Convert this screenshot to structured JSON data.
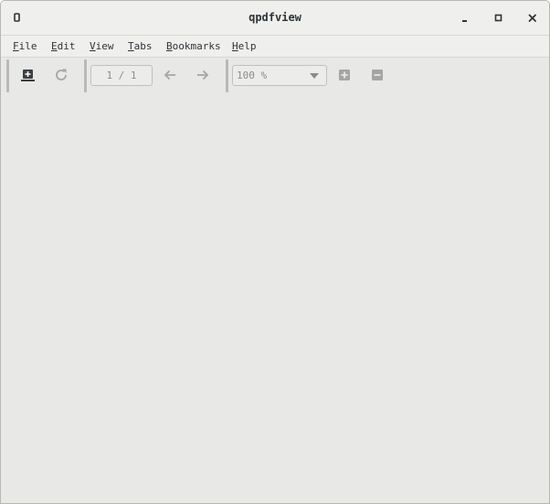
{
  "window": {
    "title": "qpdfview"
  },
  "menubar": {
    "items": [
      {
        "mnemonic": "F",
        "rest": "ile"
      },
      {
        "mnemonic": "E",
        "rest": "dit"
      },
      {
        "mnemonic": "V",
        "rest": "iew"
      },
      {
        "mnemonic": "T",
        "rest": "abs"
      },
      {
        "mnemonic": "B",
        "rest": "ookmarks"
      },
      {
        "mnemonic": "H",
        "rest": "elp"
      }
    ]
  },
  "toolbar": {
    "page_field": "1 / 1",
    "zoom_value": "100 %"
  },
  "icons": {
    "app": "app-icon",
    "minimize": "minimize-icon",
    "maximize": "maximize-icon",
    "close": "close-icon",
    "open": "open-document-icon",
    "reload": "reload-icon",
    "previous": "arrow-left-icon",
    "next": "arrow-right-icon",
    "zoom_in": "zoom-in-icon",
    "zoom_out": "zoom-out-icon",
    "dropdown": "chevron-down-icon"
  },
  "colors": {
    "background": "#e8e8e7",
    "titlebar": "#efefee",
    "text": "#2e3436",
    "disabled_text": "#8a8c8a",
    "icon_disabled": "#a4a6a4"
  }
}
